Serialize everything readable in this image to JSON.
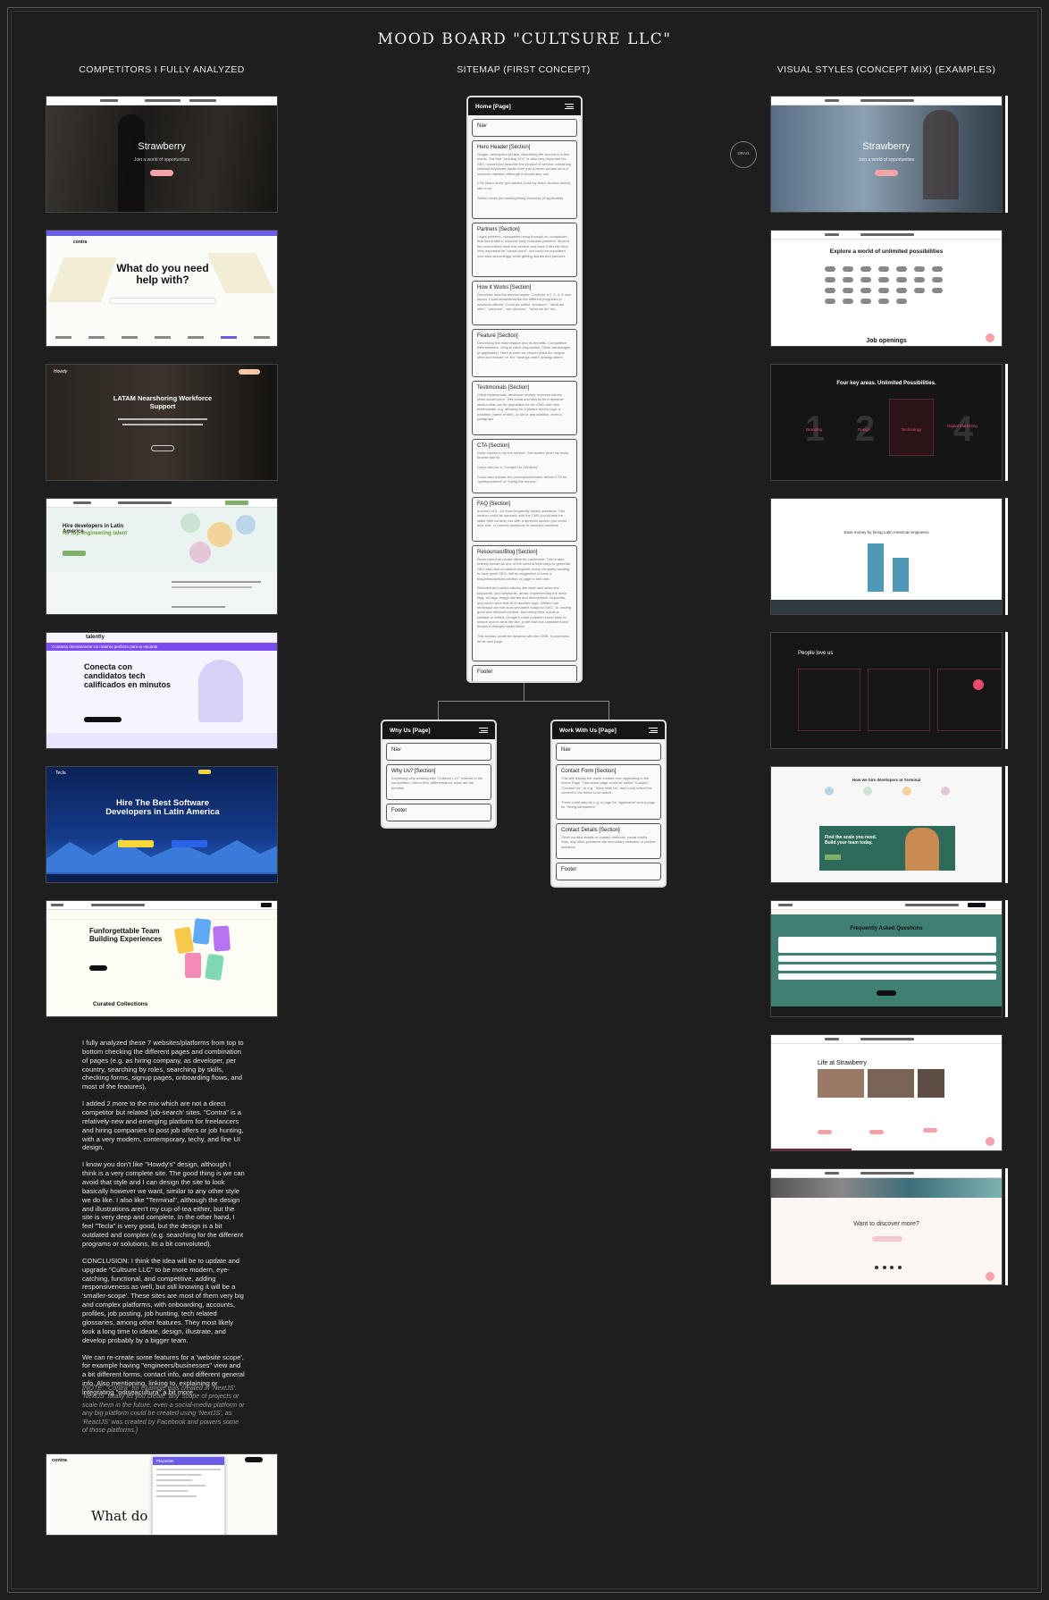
{
  "title": "MOOD BOARD \"CULTSURE LLC\"",
  "columns": {
    "competitors": "COMPETITORS I FULLY ANALYZED",
    "sitemap": "SITEMAP (FIRST CONCEPT)",
    "visual": "VISUAL STYLES (CONCEPT MIX) (EXAMPLES)"
  },
  "drag_label": "DRAG",
  "competitors": [
    {
      "headline": "Strawberry",
      "sub": "Join a world of opportunities"
    },
    {
      "headline": "What do you need help with?",
      "brand": "contra"
    },
    {
      "headline": "LATAM Nearshoring Workforce Support",
      "brand": "Howdy"
    },
    {
      "headline": "Hire developers in Latin America",
      "sub": "for top engineering talent"
    },
    {
      "headline": "Conecta con candidatos tech calificados en minutos",
      "brand": "talently",
      "banner": "Contacta directamente con talento perfecto para tu vacante"
    },
    {
      "headline": "Hire The Best Software Developers in Latin America",
      "brand": "Tecla"
    },
    {
      "headline": "Funforgettable Team Building Experiences",
      "sub": "Curated Collections"
    }
  ],
  "contra_bottom": {
    "brand": "contra",
    "headline": "What do you",
    "panel": "Playwriter"
  },
  "visuals": [
    {
      "headline": "Strawberry",
      "sub": "Join a world of opportunities"
    },
    {
      "headline": "Explore a world of unlimited possibilities",
      "sub": "Job openings"
    },
    {
      "headline": "Four key areas. Unlimited Possibilities.",
      "items": [
        "Branding",
        "Design",
        "Technology",
        "Digital Marketing"
      ]
    },
    {
      "headline": "Save money by hiring Latin American engineers"
    },
    {
      "headline": "People love us"
    },
    {
      "headline": "Find the scale you need. Build your team today.",
      "sub": "How we hire developers at Terminal"
    },
    {
      "headline": "Frequently Asked Questions"
    },
    {
      "headline": "Life at Strawberry"
    },
    {
      "headline": "Want to discover more?"
    }
  ],
  "sitemap": {
    "home": {
      "title": "Home [Page]",
      "sections": [
        {
          "t": "Nav",
          "d": ""
        },
        {
          "t": "Hero Header [Section]",
          "d": "Slogan, descriptive phrase, describing the service in a few words. The first \"heading 1/h1\" is also very important for SEO, should just describe the product or service containing relevant keywords (aside from just a clever phrase as is a common mistake) although it should also call\n\nCTA (learn more, get started (hold my team, browse talent), talk to us\n\nSwitch views job hunting/hiring business (if applicable)"
        },
        {
          "t": "Partners [Section]",
          "d": "Logos partners, companies hiring through us, companies that found talent, success story business partners. Most of the competitors have this section and have it directly here. Very important for \"social proof\", but could be populated over time accordingly, while getting stories and partners"
        },
        {
          "t": "How it Works [Section]",
          "d": "Describes how the service works. Could be a 2, 3, 4, 5 card layout. Could show/describe the different programs or solutions offered. Could be called \"solutions\", \"what we offer\", \"services\", \"our services\", \"what we do\" etc."
        },
        {
          "t": "Feature [Section]",
          "d": "Describing the main feature and its benefits. Competitive differentiation. Unique value proposition. Other advantages (if applicable). Here is were we should show the unique offer and include i.e. the \"savings chart\" among others"
        },
        {
          "t": "Testimonials [Section]",
          "d": "Client testimonials, developer stories, success stories. More social proof. This could and should be a dynamic section that can be populated via the CMS with new testimonials, e.g. allowing for a picture and/or logo, a headline (name of title), a rule or any addition, even a paragraph"
        },
        {
          "t": "CTA [Section]",
          "d": "Invite visitors to try the service. Get started (hold my team, browse talent)\n\nCould also be a \"Contact Us (Section)\"\n\nCould also explain the process/procedure before CTA for \"getting started\" or \"trying the service\""
        },
        {
          "t": "FAQ [Section]",
          "d": "A series of 5 - 10 most frequently asked questions. This section could be dynamic with the CMS (could also be static html content) but with a dynamic section you could add, edit, or remove questions or answers overtime"
        },
        {
          "t": "Resources/Blog [Section]",
          "d": "Resources that create value for customers. This is also entirely known as one of the content best ways to generate SEO and rank on search engines, every company wanting to have good SEO, will be suggested to have a blog/news/articles section or page in their site.\n\nRelevant and useful articles are what rank when the keywords, your keywords, areas, implementing the meta tags, alt tags, image names and descriptions, keywords, and much more that fill in another topic. Written can technique are the most prevalent today for SEO, i.e. having good and relevant content. Also every time a post is created or edited, Google's robot (crawler) come back to search and re-rank the site, a site that has consistent and frequent changes ranks better\n\nThis section would be dynamic with the CMS. It could also be its own page"
        },
        {
          "t": "Footer",
          "d": ""
        }
      ]
    },
    "why": {
      "title": "Why Us [Page]",
      "sections": [
        {
          "t": "Nav",
          "d": ""
        },
        {
          "t": "Why Us? [Section]",
          "d": "Explaining why working with \"Cultsure LLC\" instead of the competition, inform their differentiators, what are the benefits"
        },
        {
          "t": "Footer",
          "d": ""
        }
      ]
    },
    "work": {
      "title": "Work With Us [Page]",
      "sections": [
        {
          "t": "Nav",
          "d": ""
        },
        {
          "t": "Contact Form [Section]",
          "d": "This will display the same contact form appearing in the Home Page. This whole page could be called \"Contact\", \"Contact Us\", or e.g. \"Work With Us\" and could reflect the content in the fields to be asked\n\nThere could also be e.g. a page for \"applicants\" and a page for \"hiring companies\""
        },
        {
          "t": "Contact Details [Section]",
          "d": "Other contact details or contact methods, social media links, any other presence the secondary websites or partner websites"
        },
        {
          "t": "Footer",
          "d": ""
        }
      ]
    }
  },
  "notes": [
    "I fully analyzed these 7 websites/platforms from top to bottom checking the different pages and combination of pages (e.g. as hiring company, as developer, per country, searching by roles, searching by skills, checking forms, signup pages, onboarding flows, and most of the features).",
    "I added 2 more to the mix which are not a direct competitor but related 'job-search' sites. \"Contra\" is a relatively-new and emerging platform for freelancers and hiring companies to post job offers or job hunting, with a very modern, contemporary, techy, and fine UI design.",
    "I know you don't like \"Howdy's\" design, although I think is a very complete site. The good thing is we can avoid that style and I can design the site to look basically however we want, similar to any other style we do like. I also like \"Terminal\", although the design and illustrations aren't my cup-of-tea either, but the site is very deep and complete. In the other hand, I feel \"Tecla\" is very good, but the design is a bit outdated and complex (e.g. searching for the different programs or solutions, its a bit convoluted).",
    "CONCLUSION: I think the idea will be to update and upgrade \"Cultsure LLC\" to be more modern, eye-catching, functional, and competitive, adding responsiveness as well, but still knowing it will be a 'smaller-scope'. These sites are most of them very big and complex platforms, with onboarding, accounts, profiles, job posting, job hunting, tech related glossaries, among other features. They most likely took a long time to ideate, design, illustrate, and develop probably by a bigger team.",
    "We can re-create some features for a 'website scope', for example having \"engineers/businesses\" view and a bit different forms, contact info, and different general info. Also mentioning, linking to, explaining or integrating \"odiseacultura\" a bit more."
  ],
  "note_italic": "[NOTE: \"Contra\" for example was created in 'NextJS'. 'NextJS' totally let you create 'any' scope of projects or scale them in the future, even a social-media platform or any big platform could be created using 'NextJS', as 'ReactJS' was created by Facebook and powers some of those platforms.]"
}
